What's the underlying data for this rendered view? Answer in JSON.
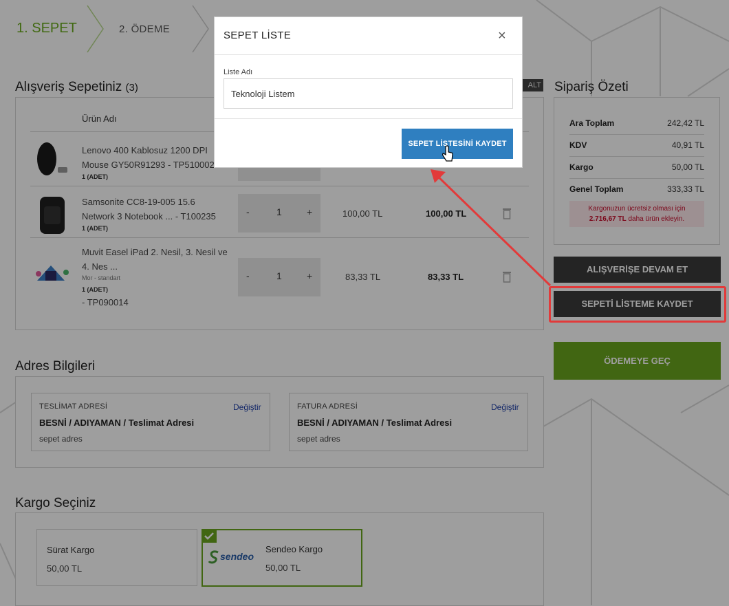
{
  "steps": {
    "step1": "1. SEPET",
    "step2": "2. ÖDEME"
  },
  "cart": {
    "title": "Alışveriş Sepetiniz",
    "count": "(3)",
    "hidden_label": "ALT",
    "col_product": "Ürün Adı",
    "items": [
      {
        "name_line1": "Lenovo 400 Kablosuz 1200 DPI",
        "name_line2": "Mouse GY50R91293 - TP510002",
        "qty_label": "1 (ADET)"
      },
      {
        "name_line1": "Samsonite CC8-19-005 15.6",
        "name_line2": "Network 3 Notebook ... - T100235",
        "qty_label": "1 (ADET)",
        "qty": "1",
        "minus": "-",
        "plus": "+",
        "price": "100,00 TL",
        "total": "100,00 TL"
      },
      {
        "name_line1": "Muvit Easel iPad 2. Nesil, 3. Nesil ve",
        "name_line2": "4. Nes ...",
        "variant": "Mor - standart",
        "qty_label": "1 (ADET)",
        "code": "- TP090014",
        "qty": "1",
        "minus": "-",
        "plus": "+",
        "price": "83,33 TL",
        "total": "83,33 TL"
      }
    ]
  },
  "address": {
    "title": "Adres Bilgileri",
    "delivery": {
      "heading": "TESLİMAT ADRESİ",
      "change": "Değiştir",
      "line1": "BESNİ / ADIYAMAN / Teslimat Adresi",
      "line2": "sepet adres"
    },
    "billing": {
      "heading": "FATURA ADRESİ",
      "change": "Değiştir",
      "line1": "BESNİ / ADIYAMAN / Teslimat Adresi",
      "line2": "sepet adres"
    }
  },
  "shipping": {
    "title": "Kargo Seçiniz",
    "options": [
      {
        "name": "Sürat Kargo",
        "price": "50,00 TL"
      },
      {
        "name": "Sendeo Kargo",
        "price": "50,00 TL",
        "logo_text": "sendeo",
        "selected": true
      }
    ]
  },
  "summary": {
    "title": "Sipariş Özeti",
    "rows": [
      {
        "label": "Ara Toplam",
        "value": "242,42 TL"
      },
      {
        "label": "KDV",
        "value": "40,91 TL"
      },
      {
        "label": "Kargo",
        "value": "50,00 TL"
      },
      {
        "label": "Genel Toplam",
        "value": "333,33 TL"
      }
    ],
    "notice_line1": "Kargonuzun ücretsiz olması için",
    "notice_amount": "2.716,67 TL",
    "notice_rest": "daha ürün ekleyin.",
    "continue_btn": "ALIŞVERİŞE DEVAM ET",
    "save_list_btn": "SEPETİ LİSTEME KAYDET",
    "checkout_btn": "ÖDEMEYE GEÇ"
  },
  "modal": {
    "title": "SEPET LİSTE",
    "close": "×",
    "field_label": "Liste Adı",
    "field_value": "Teknoloji Listem",
    "save_btn": "SEPET LİSTESİNİ KAYDET"
  },
  "colors": {
    "accent_green": "#69a51e",
    "modal_button": "#2f7fc0",
    "highlight": "#e23a3a",
    "notice_text": "#c8102e"
  }
}
